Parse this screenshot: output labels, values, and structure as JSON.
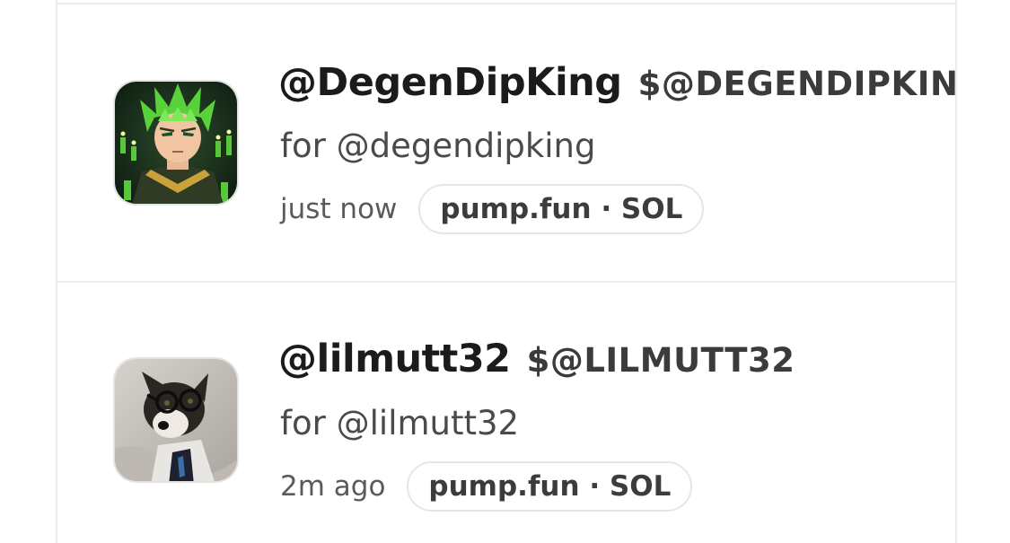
{
  "feed": {
    "items": [
      {
        "handle": "@DegenDipKing",
        "ticker": "$@DEGENDIPKIN",
        "for_text": "for @degendipking",
        "time": "just now",
        "platform": "pump.fun · SOL",
        "avatar_icon": "anime-character-avatar"
      },
      {
        "handle": "@lilmutt32",
        "ticker": "$@LILMUTT32",
        "for_text": "for @lilmutt32",
        "time": "2m ago",
        "platform": "pump.fun · SOL",
        "avatar_icon": "dog-with-glasses-avatar"
      }
    ]
  },
  "colors": {
    "border": "#ececec",
    "handle": "#1b1b1b",
    "muted": "#4a4a4a",
    "accent_green": "#6fd43a"
  }
}
